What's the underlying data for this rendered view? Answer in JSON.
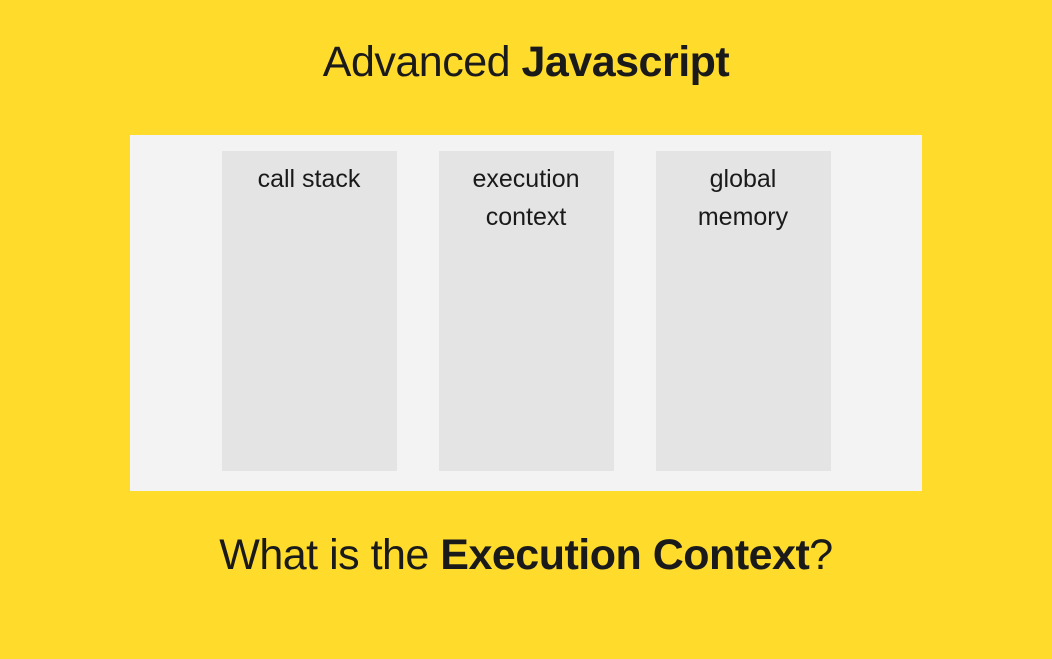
{
  "title": {
    "prefix": "Advanced ",
    "bold": "Javascript"
  },
  "columns": [
    {
      "line1": "call stack",
      "line2": ""
    },
    {
      "line1": "execution",
      "line2": "context"
    },
    {
      "line1": "global",
      "line2": "memory"
    }
  ],
  "subtitle": {
    "prefix": "What is the ",
    "bold": "Execution Context",
    "suffix": "?"
  }
}
